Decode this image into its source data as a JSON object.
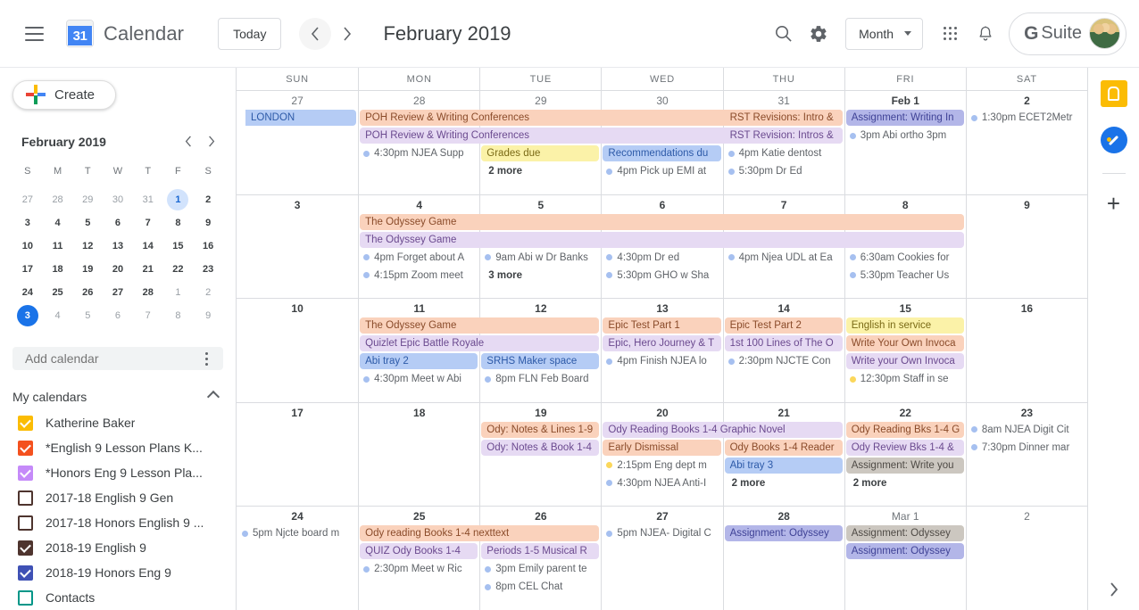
{
  "header": {
    "menu_icon": "hamburger-icon",
    "logo_day": "31",
    "brand": "Calendar",
    "today_label": "Today",
    "prev_icon": "chevron-left-icon",
    "next_icon": "chevron-right-icon",
    "period_title": "February 2019",
    "search_icon": "search-icon",
    "settings_icon": "gear-icon",
    "view_label": "Month",
    "apps_icon": "apps-grid-icon",
    "notifications_icon": "bell-icon",
    "gsuite_g": "G",
    "gsuite_text": "Suite",
    "avatar": "user-avatar"
  },
  "sidebar": {
    "create_label": "Create",
    "mini": {
      "title": "February 2019",
      "prev_icon": "chevron-left-icon",
      "next_icon": "chevron-right-icon",
      "dow": [
        "S",
        "M",
        "T",
        "W",
        "T",
        "F",
        "S"
      ],
      "weeks": [
        [
          {
            "d": "27",
            "s": "oth"
          },
          {
            "d": "28",
            "s": "oth"
          },
          {
            "d": "29",
            "s": "oth"
          },
          {
            "d": "30",
            "s": "oth"
          },
          {
            "d": "31",
            "s": "oth"
          },
          {
            "d": "1",
            "s": "sel"
          },
          {
            "d": "2",
            "s": "cur"
          }
        ],
        [
          {
            "d": "3",
            "s": "cur"
          },
          {
            "d": "4",
            "s": "cur"
          },
          {
            "d": "5",
            "s": "cur"
          },
          {
            "d": "6",
            "s": "cur"
          },
          {
            "d": "7",
            "s": "cur"
          },
          {
            "d": "8",
            "s": "cur"
          },
          {
            "d": "9",
            "s": "cur"
          }
        ],
        [
          {
            "d": "10",
            "s": "cur"
          },
          {
            "d": "11",
            "s": "cur"
          },
          {
            "d": "12",
            "s": "cur"
          },
          {
            "d": "13",
            "s": "cur"
          },
          {
            "d": "14",
            "s": "cur"
          },
          {
            "d": "15",
            "s": "cur"
          },
          {
            "d": "16",
            "s": "cur"
          }
        ],
        [
          {
            "d": "17",
            "s": "cur"
          },
          {
            "d": "18",
            "s": "cur"
          },
          {
            "d": "19",
            "s": "cur"
          },
          {
            "d": "20",
            "s": "cur"
          },
          {
            "d": "21",
            "s": "cur"
          },
          {
            "d": "22",
            "s": "cur"
          },
          {
            "d": "23",
            "s": "cur"
          }
        ],
        [
          {
            "d": "24",
            "s": "cur"
          },
          {
            "d": "25",
            "s": "cur"
          },
          {
            "d": "26",
            "s": "cur"
          },
          {
            "d": "27",
            "s": "cur"
          },
          {
            "d": "28",
            "s": "cur"
          },
          {
            "d": "1",
            "s": "oth"
          },
          {
            "d": "2",
            "s": "oth"
          }
        ],
        [
          {
            "d": "3",
            "s": "today"
          },
          {
            "d": "4",
            "s": "oth"
          },
          {
            "d": "5",
            "s": "oth"
          },
          {
            "d": "6",
            "s": "oth"
          },
          {
            "d": "7",
            "s": "oth"
          },
          {
            "d": "8",
            "s": "oth"
          },
          {
            "d": "9",
            "s": "oth"
          }
        ]
      ]
    },
    "add_calendar_placeholder": "Add calendar",
    "options_icon": "kebab-menu-icon",
    "my_calendars_label": "My calendars",
    "collapse_icon": "chevron-up-icon",
    "calendars": [
      {
        "label": "Katherine Baker",
        "color": "#fbbc04",
        "checked": true
      },
      {
        "label": "*English 9 Lesson Plans K...",
        "color": "#f4511e",
        "checked": true
      },
      {
        "label": "*Honors Eng 9 Lesson Pla...",
        "color": "#c58af9",
        "checked": true
      },
      {
        "label": "2017-18 English 9 Gen",
        "color": "#4e342e",
        "checked": false
      },
      {
        "label": "2017-18 Honors English 9 ...",
        "color": "#4e342e",
        "checked": false
      },
      {
        "label": "2018-19 English 9",
        "color": "#4e342e",
        "checked": true
      },
      {
        "label": "2018-19 Honors Eng 9",
        "color": "#3f51b5",
        "checked": true
      },
      {
        "label": "Contacts",
        "color": "#009688",
        "checked": false
      }
    ]
  },
  "calendar": {
    "day_headers": [
      "SUN",
      "MON",
      "TUE",
      "WED",
      "THU",
      "FRI",
      "SAT"
    ],
    "weeks": [
      {
        "days": [
          {
            "num": "27",
            "bold": false
          },
          {
            "num": "28",
            "bold": false
          },
          {
            "num": "29",
            "bold": false
          },
          {
            "num": "30",
            "bold": false
          },
          {
            "num": "31",
            "bold": false
          },
          {
            "num": "Feb 1",
            "bold": true
          },
          {
            "num": "2",
            "bold": true
          }
        ],
        "spans": [
          {
            "col": 0,
            "width": 1,
            "label": "LONDON",
            "color": "blue",
            "arrow": true,
            "row": 0
          },
          {
            "col": 1,
            "width": 4,
            "label": "POH Review & Writing Conferences",
            "color": "peach",
            "row": 0
          },
          {
            "col": 1,
            "width": 4,
            "label": "POH Review & Writing Conferences",
            "color": "lav",
            "row": 1
          },
          {
            "col": 4,
            "width": 1,
            "label": "RST Revisions: Intro &",
            "color": "peach",
            "row": 0
          },
          {
            "col": 4,
            "width": 1,
            "label": "RST Revision: Intros &",
            "color": "lav",
            "row": 1
          },
          {
            "col": 5,
            "width": 1,
            "label": "Assignment: Writing In",
            "color": "periwinkle",
            "row": 0
          },
          {
            "col": 3,
            "width": 1,
            "label": "Recommendations du",
            "color": "blue",
            "row": 2
          },
          {
            "col": 2,
            "width": 1,
            "label": "Grades due",
            "color": "yellow",
            "row": 2
          }
        ],
        "timed": [
          {
            "col": 1,
            "row": 2,
            "text": "4:30pm  NJEA Supp",
            "dot": "#a6c0f0"
          },
          {
            "col": 3,
            "row": 3,
            "text": "4pm  Pick up EMI at",
            "dot": "#a6c0f0"
          },
          {
            "col": 4,
            "row": 2,
            "text": "4pm  Katie dentost",
            "dot": "#a6c0f0"
          },
          {
            "col": 4,
            "row": 3,
            "text": "5:30pm  Dr Ed",
            "dot": "#a6c0f0"
          },
          {
            "col": 5,
            "row": 1,
            "text": "3pm  Abi ortho 3pm",
            "dot": "#a6c0f0"
          },
          {
            "col": 6,
            "row": 0,
            "text": "1:30pm  ECET2Metr",
            "dot": "#a6c0f0"
          }
        ],
        "more": [
          {
            "col": 2,
            "row": 3,
            "label": "2 more"
          }
        ]
      },
      {
        "days": [
          {
            "num": "3",
            "bold": true
          },
          {
            "num": "4",
            "bold": true
          },
          {
            "num": "5",
            "bold": true
          },
          {
            "num": "6",
            "bold": true
          },
          {
            "num": "7",
            "bold": true
          },
          {
            "num": "8",
            "bold": true
          },
          {
            "num": "9",
            "bold": true
          }
        ],
        "spans": [
          {
            "col": 1,
            "width": 5,
            "label": "The Odyssey Game",
            "color": "peach",
            "row": 0
          },
          {
            "col": 1,
            "width": 5,
            "label": "The Odyssey Game",
            "color": "lav",
            "row": 1
          }
        ],
        "timed": [
          {
            "col": 1,
            "row": 2,
            "text": "4pm  Forget about A",
            "dot": "#a6c0f0"
          },
          {
            "col": 1,
            "row": 3,
            "text": "4:15pm  Zoom meet",
            "dot": "#a6c0f0"
          },
          {
            "col": 2,
            "row": 2,
            "text": "9am  Abi w Dr Banks",
            "dot": "#a6c0f0"
          },
          {
            "col": 3,
            "row": 2,
            "text": "4:30pm  Dr ed",
            "dot": "#a6c0f0"
          },
          {
            "col": 3,
            "row": 3,
            "text": "5:30pm  GHO w Sha",
            "dot": "#a6c0f0"
          },
          {
            "col": 4,
            "row": 2,
            "text": "4pm  Njea UDL at Ea",
            "dot": "#a6c0f0"
          },
          {
            "col": 5,
            "row": 2,
            "text": "6:30am  Cookies for",
            "dot": "#a6c0f0"
          },
          {
            "col": 5,
            "row": 3,
            "text": "5:30pm  Teacher Us",
            "dot": "#a6c0f0"
          }
        ],
        "more": [
          {
            "col": 2,
            "row": 3,
            "label": "3 more"
          }
        ]
      },
      {
        "days": [
          {
            "num": "10",
            "bold": true
          },
          {
            "num": "11",
            "bold": true
          },
          {
            "num": "12",
            "bold": true
          },
          {
            "num": "13",
            "bold": true
          },
          {
            "num": "14",
            "bold": true
          },
          {
            "num": "15",
            "bold": true
          },
          {
            "num": "16",
            "bold": true
          }
        ],
        "spans": [
          {
            "col": 1,
            "width": 2,
            "label": "The Odyssey Game",
            "color": "peach",
            "row": 0
          },
          {
            "col": 1,
            "width": 2,
            "label": "Quizlet Epic Battle Royale",
            "color": "lav",
            "row": 1
          },
          {
            "col": 1,
            "width": 1,
            "label": "Abi tray 2",
            "color": "blue",
            "row": 2
          },
          {
            "col": 2,
            "width": 1,
            "label": "SRHS Maker space",
            "color": "blue",
            "row": 2
          },
          {
            "col": 3,
            "width": 1,
            "label": "Epic Test Part 1",
            "color": "peach",
            "row": 0
          },
          {
            "col": 3,
            "width": 1,
            "label": "Epic, Hero Journey & T",
            "color": "lav",
            "row": 1
          },
          {
            "col": 4,
            "width": 1,
            "label": "Epic Test Part 2",
            "color": "peach",
            "row": 0
          },
          {
            "col": 4,
            "width": 1,
            "label": "1st 100 Lines of The O",
            "color": "lav",
            "row": 1
          },
          {
            "col": 5,
            "width": 1,
            "label": "English in service",
            "color": "yellow",
            "row": 0
          },
          {
            "col": 5,
            "width": 1,
            "label": "Write Your Own Invoca",
            "color": "peach",
            "row": 1
          },
          {
            "col": 5,
            "width": 1,
            "label": "Write your Own Invoca",
            "color": "lav",
            "row": 2
          }
        ],
        "timed": [
          {
            "col": 1,
            "row": 3,
            "text": "4:30pm  Meet w Abi",
            "dot": "#a6c0f0"
          },
          {
            "col": 2,
            "row": 3,
            "text": "8pm  FLN Feb Board",
            "dot": "#a6c0f0"
          },
          {
            "col": 3,
            "row": 2,
            "text": "4pm  Finish NJEA lo",
            "dot": "#a6c0f0"
          },
          {
            "col": 4,
            "row": 2,
            "text": "2:30pm  NJCTE Con",
            "dot": "#a6c0f0"
          },
          {
            "col": 5,
            "row": 3,
            "text": "12:30pm  Staff in se",
            "dot": "#fbd75b"
          }
        ],
        "more": []
      },
      {
        "days": [
          {
            "num": "17",
            "bold": true
          },
          {
            "num": "18",
            "bold": true
          },
          {
            "num": "19",
            "bold": true
          },
          {
            "num": "20",
            "bold": true
          },
          {
            "num": "21",
            "bold": true
          },
          {
            "num": "22",
            "bold": true
          },
          {
            "num": "23",
            "bold": true
          }
        ],
        "spans": [
          {
            "col": 2,
            "width": 1,
            "label": "Ody: Notes & Lines 1-9",
            "color": "peach",
            "row": 0
          },
          {
            "col": 2,
            "width": 1,
            "label": "Ody: Notes & Book 1-4",
            "color": "lav",
            "row": 1
          },
          {
            "col": 3,
            "width": 2,
            "label": "Ody Reading Books 1-4 Graphic Novel",
            "color": "lav",
            "row": 0
          },
          {
            "col": 3,
            "width": 1,
            "label": "Early Dismissal",
            "color": "peach",
            "row": 1
          },
          {
            "col": 4,
            "width": 1,
            "label": "Ody Books 1-4 Reader",
            "color": "peach",
            "row": 1
          },
          {
            "col": 4,
            "width": 1,
            "label": "Abi tray 3",
            "color": "blue",
            "row": 2
          },
          {
            "col": 5,
            "width": 1,
            "label": "Ody Reading Bks 1-4 G",
            "color": "peach",
            "row": 0
          },
          {
            "col": 5,
            "width": 1,
            "label": "Ody Review Bks 1-4 &",
            "color": "lav",
            "row": 1
          },
          {
            "col": 5,
            "width": 1,
            "label": "Assignment: Write you",
            "color": "gray",
            "row": 2
          }
        ],
        "timed": [
          {
            "col": 3,
            "row": 2,
            "text": "2:15pm  Eng dept m",
            "dot": "#fbd75b"
          },
          {
            "col": 3,
            "row": 3,
            "text": "4:30pm  NJEA Anti-I",
            "dot": "#a6c0f0"
          },
          {
            "col": 6,
            "row": 0,
            "text": "8am  NJEA Digit Cit",
            "dot": "#a6c0f0"
          },
          {
            "col": 6,
            "row": 1,
            "text": "7:30pm  Dinner mar",
            "dot": "#a6c0f0"
          }
        ],
        "more": [
          {
            "col": 4,
            "row": 3,
            "label": "2 more"
          },
          {
            "col": 5,
            "row": 3,
            "label": "2 more"
          }
        ]
      },
      {
        "days": [
          {
            "num": "24",
            "bold": true
          },
          {
            "num": "25",
            "bold": true
          },
          {
            "num": "26",
            "bold": true
          },
          {
            "num": "27",
            "bold": true
          },
          {
            "num": "28",
            "bold": true
          },
          {
            "num": "Mar 1",
            "bold": false
          },
          {
            "num": "2",
            "bold": false
          }
        ],
        "spans": [
          {
            "col": 1,
            "width": 2,
            "label": "Ody reading Books 1-4 nexttext",
            "color": "peach",
            "row": 0
          },
          {
            "col": 1,
            "width": 1,
            "label": "QUIZ Ody Books 1-4",
            "color": "lav",
            "row": 1
          },
          {
            "col": 2,
            "width": 1,
            "label": "Periods 1-5 Musical R",
            "color": "lav",
            "row": 1
          },
          {
            "col": 4,
            "width": 1,
            "label": "Assignment: Odyssey",
            "color": "periwinkle",
            "row": 0
          },
          {
            "col": 5,
            "width": 1,
            "label": "Assignment: Odyssey",
            "color": "gray",
            "row": 0
          },
          {
            "col": 5,
            "width": 1,
            "label": "Assignment: Odyssey",
            "color": "periwinkle",
            "row": 1
          }
        ],
        "timed": [
          {
            "col": 0,
            "row": 0,
            "text": "5pm  Njcte board m",
            "dot": "#a6c0f0"
          },
          {
            "col": 1,
            "row": 2,
            "text": "2:30pm  Meet w Ric",
            "dot": "#a6c0f0"
          },
          {
            "col": 2,
            "row": 2,
            "text": "3pm  Emily parent te",
            "dot": "#a6c0f0"
          },
          {
            "col": 2,
            "row": 3,
            "text": "8pm  CEL Chat",
            "dot": "#a6c0f0"
          },
          {
            "col": 3,
            "row": 0,
            "text": "5pm  NJEA- Digital C",
            "dot": "#a6c0f0"
          }
        ],
        "more": []
      }
    ]
  },
  "rail": {
    "keep_icon": "google-keep-icon",
    "tasks_icon": "google-tasks-icon",
    "add_icon": "add-addon-icon",
    "expand_icon": "chevron-right-icon"
  }
}
